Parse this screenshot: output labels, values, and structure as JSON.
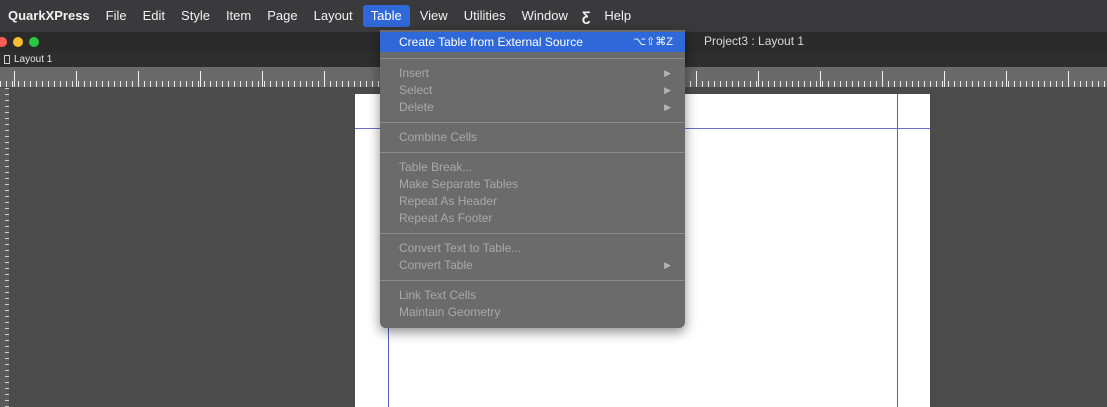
{
  "menubar": {
    "app_name": "QuarkXPress",
    "items": [
      "File",
      "Edit",
      "Style",
      "Item",
      "Page",
      "Layout",
      "Table",
      "View",
      "Utilities",
      "Window"
    ],
    "active_item": "Table",
    "script_icon": "script-menu-icon",
    "help": "Help"
  },
  "window": {
    "title": "Project3 : Layout 1"
  },
  "tabbar": {
    "tab_label": "Layout 1"
  },
  "table_menu": {
    "create_from_external": "Create Table from External Source",
    "create_from_external_shortcut": "⌥⇧⌘Z",
    "insert": "Insert",
    "select": "Select",
    "delete": "Delete",
    "combine_cells": "Combine Cells",
    "table_break": "Table Break...",
    "make_separate_tables": "Make Separate Tables",
    "repeat_as_header": "Repeat As Header",
    "repeat_as_footer": "Repeat As Footer",
    "convert_text_to_table": "Convert Text to Table...",
    "convert_table": "Convert Table",
    "link_text_cells": "Link Text Cells",
    "maintain_geometry": "Maintain Geometry",
    "submenu_arrow": "▶"
  },
  "colors": {
    "menubar_bg": "#3a3a3c",
    "highlight": "#2f68d8",
    "menu_bg": "#6b6b6b",
    "workspace_bg": "#4b4b4b",
    "guide": "#5b5fbf"
  }
}
